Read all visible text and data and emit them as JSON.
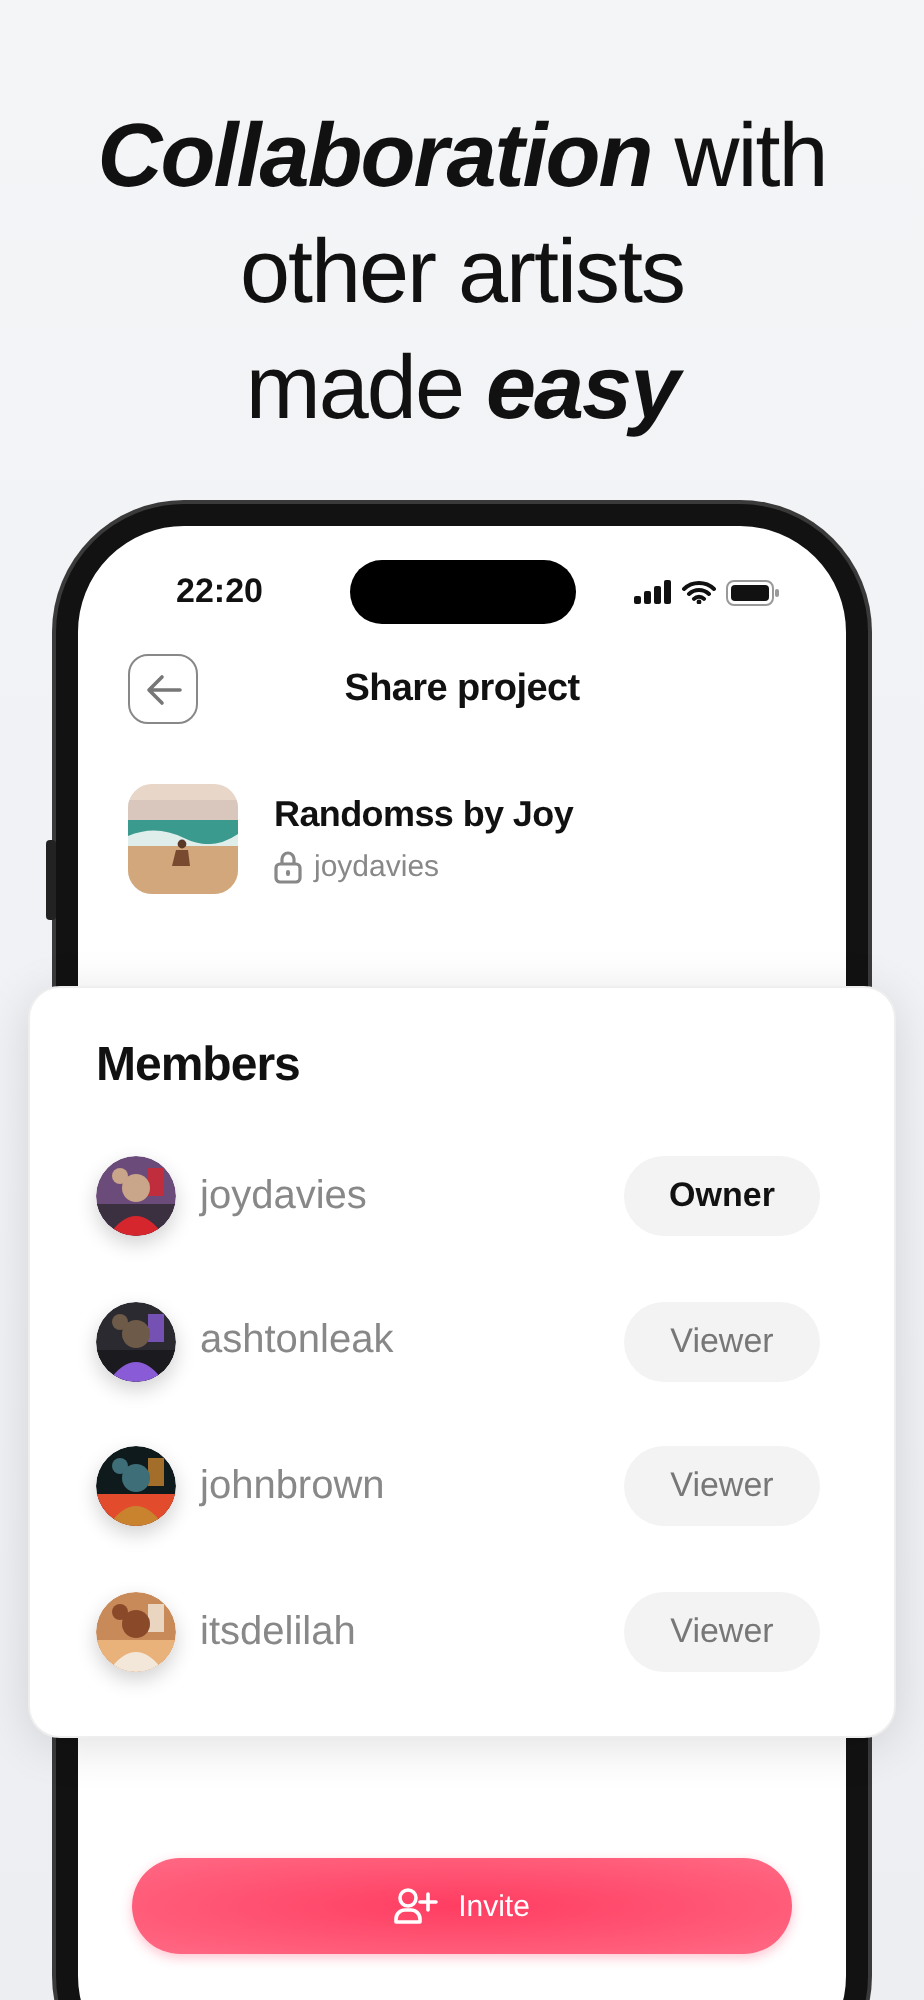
{
  "headline": {
    "lines": [
      "*Collaboration* with",
      "other artists",
      "made *easy*"
    ]
  },
  "status_bar": {
    "time": "22:20"
  },
  "header": {
    "title": "Share project"
  },
  "project": {
    "title": "Randomss by Joy",
    "owner": "joydavies",
    "private": true
  },
  "members": {
    "title": "Members",
    "items": [
      {
        "username": "joydavies",
        "role": "Owner",
        "kind": "owner"
      },
      {
        "username": "ashtonleak",
        "role": "Viewer",
        "kind": "viewer"
      },
      {
        "username": "johnbrown",
        "role": "Viewer",
        "kind": "viewer"
      },
      {
        "username": "itsdelilah",
        "role": "Viewer",
        "kind": "viewer"
      }
    ]
  },
  "invite_button": {
    "label": "Invite"
  }
}
